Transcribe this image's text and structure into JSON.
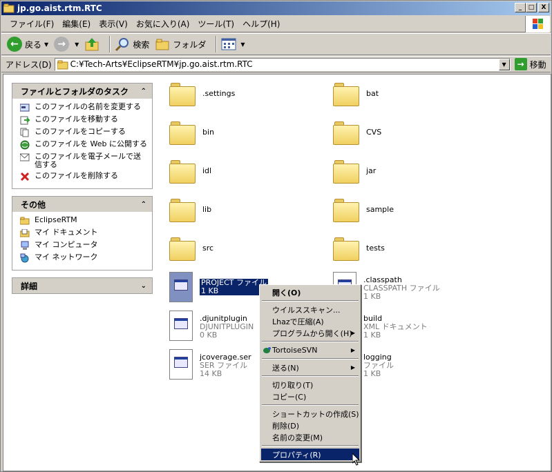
{
  "window": {
    "title": "jp.go.aist.rtm.RTC"
  },
  "title_buttons": {
    "minimize": "_",
    "maximize": "□",
    "close": "X"
  },
  "menu": [
    "ファイル(F)",
    "編集(E)",
    "表示(V)",
    "お気に入り(A)",
    "ツール(T)",
    "ヘルプ(H)"
  ],
  "toolbar": {
    "back": "戻る",
    "search": "検索",
    "folders": "フォルダ"
  },
  "address": {
    "label": "アドレス(D)",
    "path": "C:¥Tech-Arts¥EclipseRTM¥jp.go.aist.rtm.RTC",
    "go": "移動"
  },
  "tasks_panel": {
    "title": "ファイルとフォルダのタスク",
    "items": [
      {
        "label": "このファイルの名前を変更する",
        "icon": "rename-icon"
      },
      {
        "label": "このファイルを移動する",
        "icon": "move-icon"
      },
      {
        "label": "このファイルをコピーする",
        "icon": "copy-icon"
      },
      {
        "label": "このファイルを Web に公開する",
        "icon": "web-publish-icon"
      },
      {
        "label": "このファイルを電子メールで送信する",
        "icon": "email-icon"
      },
      {
        "label": "このファイルを削除する",
        "icon": "delete-icon"
      }
    ]
  },
  "other_panel": {
    "title": "その他",
    "items": [
      {
        "label": "EclipseRTM",
        "icon": "folder-icon"
      },
      {
        "label": "マイ ドキュメント",
        "icon": "my-documents-icon"
      },
      {
        "label": "マイ コンピュータ",
        "icon": "my-computer-icon"
      },
      {
        "label": "マイ ネットワーク",
        "icon": "my-network-icon"
      }
    ]
  },
  "details_panel": {
    "title": "詳細"
  },
  "files": [
    {
      "name": ".settings",
      "type": "folder"
    },
    {
      "name": "bat",
      "type": "folder"
    },
    {
      "name": "bin",
      "type": "folder"
    },
    {
      "name": "CVS",
      "type": "folder"
    },
    {
      "name": "idl",
      "type": "folder"
    },
    {
      "name": "jar",
      "type": "folder"
    },
    {
      "name": "lib",
      "type": "folder"
    },
    {
      "name": "sample",
      "type": "folder"
    },
    {
      "name": "src",
      "type": "folder"
    },
    {
      "name": "tests",
      "type": "folder"
    },
    {
      "name": "",
      "kind": "PROJECT ファイル",
      "size": "1 KB",
      "type": "doc",
      "selected": true
    },
    {
      "name": ".classpath",
      "kind": "CLASSPATH ファイル",
      "size": "1 KB",
      "type": "doc"
    },
    {
      "name": ".djunitplugin",
      "kind": "DJUNITPLUGIN",
      "size": "0 KB",
      "type": "doc"
    },
    {
      "name": "build",
      "kind": "XML ドキュメント",
      "size": "1 KB",
      "type": "doc"
    },
    {
      "name": "jcoverage.ser",
      "kind": "SER ファイル",
      "size": "14 KB",
      "type": "doc"
    },
    {
      "name": "logging",
      "kind": "ファイル",
      "size": "1 KB",
      "type": "doc"
    }
  ],
  "context_menu": {
    "open": "開く(O)",
    "virus_scan": "ウイルススキャン...",
    "lhaz": "Lhazで圧縮(A)",
    "open_with": "プログラムから開く(H)",
    "tortoise": "TortoiseSVN",
    "send_to": "送る(N)",
    "cut": "切り取り(T)",
    "copy": "コピー(C)",
    "shortcut": "ショートカットの作成(S)",
    "delete": "削除(D)",
    "rename": "名前の変更(M)",
    "properties": "プロパティ(R)"
  }
}
